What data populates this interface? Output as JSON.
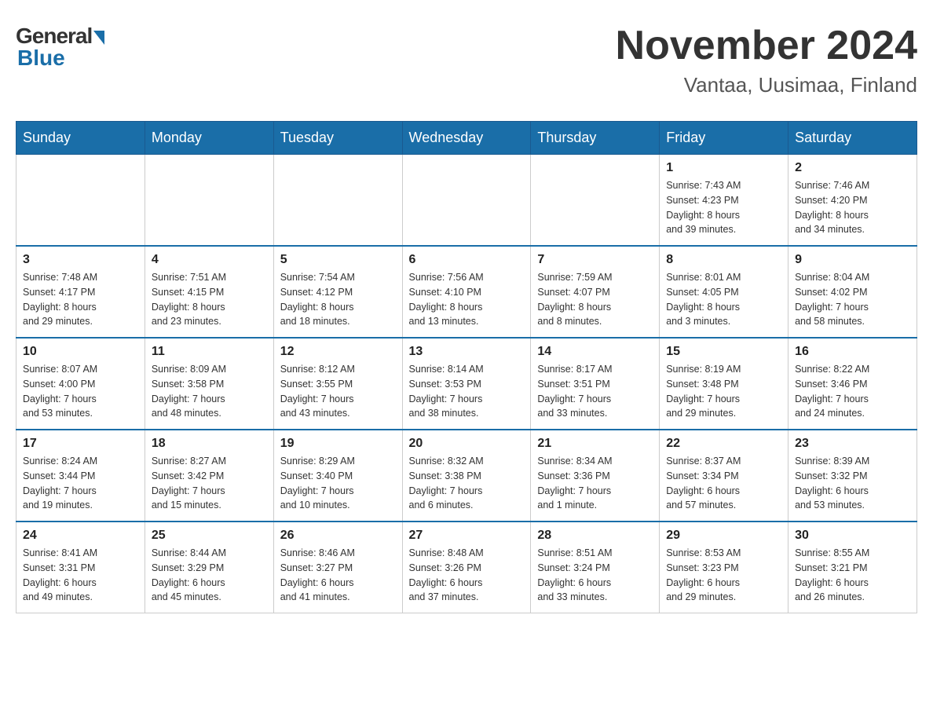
{
  "header": {
    "logo": {
      "general": "General",
      "blue": "Blue"
    },
    "title": "November 2024",
    "subtitle": "Vantaa, Uusimaa, Finland"
  },
  "weekdays": [
    "Sunday",
    "Monday",
    "Tuesday",
    "Wednesday",
    "Thursday",
    "Friday",
    "Saturday"
  ],
  "weeks": [
    [
      {
        "day": "",
        "info": ""
      },
      {
        "day": "",
        "info": ""
      },
      {
        "day": "",
        "info": ""
      },
      {
        "day": "",
        "info": ""
      },
      {
        "day": "",
        "info": ""
      },
      {
        "day": "1",
        "info": "Sunrise: 7:43 AM\nSunset: 4:23 PM\nDaylight: 8 hours\nand 39 minutes."
      },
      {
        "day": "2",
        "info": "Sunrise: 7:46 AM\nSunset: 4:20 PM\nDaylight: 8 hours\nand 34 minutes."
      }
    ],
    [
      {
        "day": "3",
        "info": "Sunrise: 7:48 AM\nSunset: 4:17 PM\nDaylight: 8 hours\nand 29 minutes."
      },
      {
        "day": "4",
        "info": "Sunrise: 7:51 AM\nSunset: 4:15 PM\nDaylight: 8 hours\nand 23 minutes."
      },
      {
        "day": "5",
        "info": "Sunrise: 7:54 AM\nSunset: 4:12 PM\nDaylight: 8 hours\nand 18 minutes."
      },
      {
        "day": "6",
        "info": "Sunrise: 7:56 AM\nSunset: 4:10 PM\nDaylight: 8 hours\nand 13 minutes."
      },
      {
        "day": "7",
        "info": "Sunrise: 7:59 AM\nSunset: 4:07 PM\nDaylight: 8 hours\nand 8 minutes."
      },
      {
        "day": "8",
        "info": "Sunrise: 8:01 AM\nSunset: 4:05 PM\nDaylight: 8 hours\nand 3 minutes."
      },
      {
        "day": "9",
        "info": "Sunrise: 8:04 AM\nSunset: 4:02 PM\nDaylight: 7 hours\nand 58 minutes."
      }
    ],
    [
      {
        "day": "10",
        "info": "Sunrise: 8:07 AM\nSunset: 4:00 PM\nDaylight: 7 hours\nand 53 minutes."
      },
      {
        "day": "11",
        "info": "Sunrise: 8:09 AM\nSunset: 3:58 PM\nDaylight: 7 hours\nand 48 minutes."
      },
      {
        "day": "12",
        "info": "Sunrise: 8:12 AM\nSunset: 3:55 PM\nDaylight: 7 hours\nand 43 minutes."
      },
      {
        "day": "13",
        "info": "Sunrise: 8:14 AM\nSunset: 3:53 PM\nDaylight: 7 hours\nand 38 minutes."
      },
      {
        "day": "14",
        "info": "Sunrise: 8:17 AM\nSunset: 3:51 PM\nDaylight: 7 hours\nand 33 minutes."
      },
      {
        "day": "15",
        "info": "Sunrise: 8:19 AM\nSunset: 3:48 PM\nDaylight: 7 hours\nand 29 minutes."
      },
      {
        "day": "16",
        "info": "Sunrise: 8:22 AM\nSunset: 3:46 PM\nDaylight: 7 hours\nand 24 minutes."
      }
    ],
    [
      {
        "day": "17",
        "info": "Sunrise: 8:24 AM\nSunset: 3:44 PM\nDaylight: 7 hours\nand 19 minutes."
      },
      {
        "day": "18",
        "info": "Sunrise: 8:27 AM\nSunset: 3:42 PM\nDaylight: 7 hours\nand 15 minutes."
      },
      {
        "day": "19",
        "info": "Sunrise: 8:29 AM\nSunset: 3:40 PM\nDaylight: 7 hours\nand 10 minutes."
      },
      {
        "day": "20",
        "info": "Sunrise: 8:32 AM\nSunset: 3:38 PM\nDaylight: 7 hours\nand 6 minutes."
      },
      {
        "day": "21",
        "info": "Sunrise: 8:34 AM\nSunset: 3:36 PM\nDaylight: 7 hours\nand 1 minute."
      },
      {
        "day": "22",
        "info": "Sunrise: 8:37 AM\nSunset: 3:34 PM\nDaylight: 6 hours\nand 57 minutes."
      },
      {
        "day": "23",
        "info": "Sunrise: 8:39 AM\nSunset: 3:32 PM\nDaylight: 6 hours\nand 53 minutes."
      }
    ],
    [
      {
        "day": "24",
        "info": "Sunrise: 8:41 AM\nSunset: 3:31 PM\nDaylight: 6 hours\nand 49 minutes."
      },
      {
        "day": "25",
        "info": "Sunrise: 8:44 AM\nSunset: 3:29 PM\nDaylight: 6 hours\nand 45 minutes."
      },
      {
        "day": "26",
        "info": "Sunrise: 8:46 AM\nSunset: 3:27 PM\nDaylight: 6 hours\nand 41 minutes."
      },
      {
        "day": "27",
        "info": "Sunrise: 8:48 AM\nSunset: 3:26 PM\nDaylight: 6 hours\nand 37 minutes."
      },
      {
        "day": "28",
        "info": "Sunrise: 8:51 AM\nSunset: 3:24 PM\nDaylight: 6 hours\nand 33 minutes."
      },
      {
        "day": "29",
        "info": "Sunrise: 8:53 AM\nSunset: 3:23 PM\nDaylight: 6 hours\nand 29 minutes."
      },
      {
        "day": "30",
        "info": "Sunrise: 8:55 AM\nSunset: 3:21 PM\nDaylight: 6 hours\nand 26 minutes."
      }
    ]
  ]
}
